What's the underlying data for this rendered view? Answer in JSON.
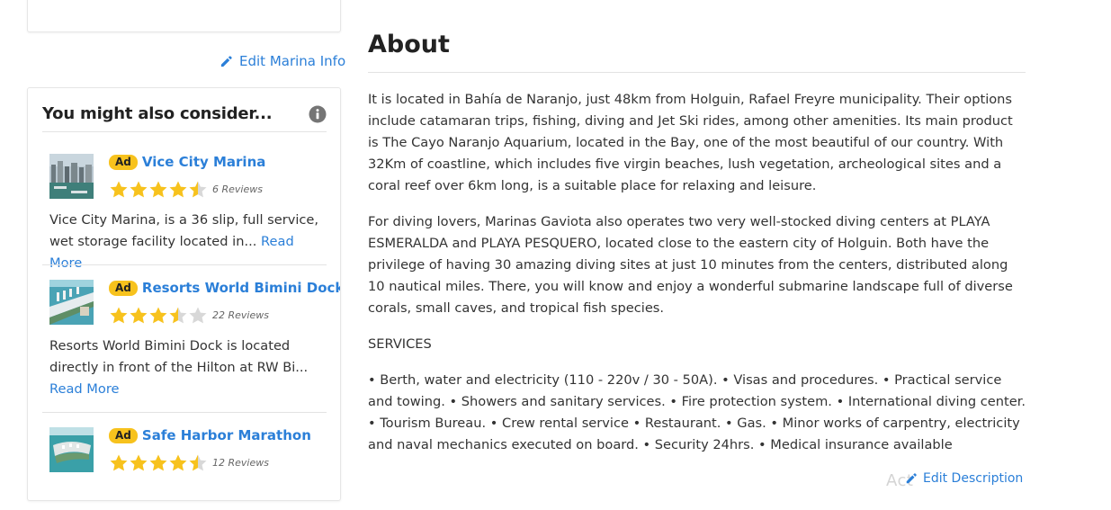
{
  "sidebar": {
    "edit_marina_label": "Edit Marina Info",
    "consider_title": "You might also consider...",
    "ad_label": "Ad",
    "read_more_label": "Read More",
    "items": [
      {
        "name": "Vice City Marina",
        "rating": 4.5,
        "reviews": "6 Reviews",
        "description": "Vice City Marina, is a 36 slip, full service, wet storage facility located in...",
        "read_more": "Read More"
      },
      {
        "name": "Resorts World Bimini Dock",
        "rating": 3.5,
        "reviews": "22 Reviews",
        "description": "Resorts World Bimini Dock is located directly in front of the Hilton at RW Bi...",
        "read_more": "Read More"
      },
      {
        "name": "Safe Harbor Marathon",
        "rating": 4.5,
        "reviews": "12 Reviews"
      }
    ]
  },
  "about": {
    "title": "About",
    "paragraphs": [
      "It is located in Bahía de Naranjo, just 48km from Holguin, Rafael Freyre municipality. Their options include catamaran trips, fishing, diving and Jet Ski rides, among other amenities. Its main product is The Cayo Naranjo Aquarium, located in the Bay, one of the most beautiful of our country. With 32Km of coastline, which includes five virgin beaches, lush vegetation, archeological sites and a coral reef over 6km long, is a suitable place for relaxing and leisure.",
      "For diving lovers, Marinas Gaviota also operates two very well-stocked diving centers at PLAYA ESMERALDA and PLAYA PESQUERO, located close to the eastern city of Holguin. Both have the privilege of having 30 amazing diving sites at just 10 minutes from the centers, distributed along 10 nautical miles. There, you will know and enjoy a wonderful submarine landscape full of diverse corals, small caves, and tropical fish species.",
      "SERVICES",
      "• Berth, water and electricity (110 - 220v / 30 - 50A). • Visas and procedures. • Practical service and towing. • Showers and sanitary services. • Fire protection system. • International diving center. • Tourism Bureau. • Crew rental service • Restaurant. • Gas. • Minor works of carpentry, electricity and naval mechanics executed on board. • Security 24hrs. • Medical insurance available"
    ],
    "edit_description_label": "Edit Description",
    "watermark": "Act"
  },
  "colors": {
    "link": "#2b7fd8",
    "star": "#f7c21d",
    "star_empty": "#d8d8d8",
    "ad_badge": "#f7c21d"
  }
}
